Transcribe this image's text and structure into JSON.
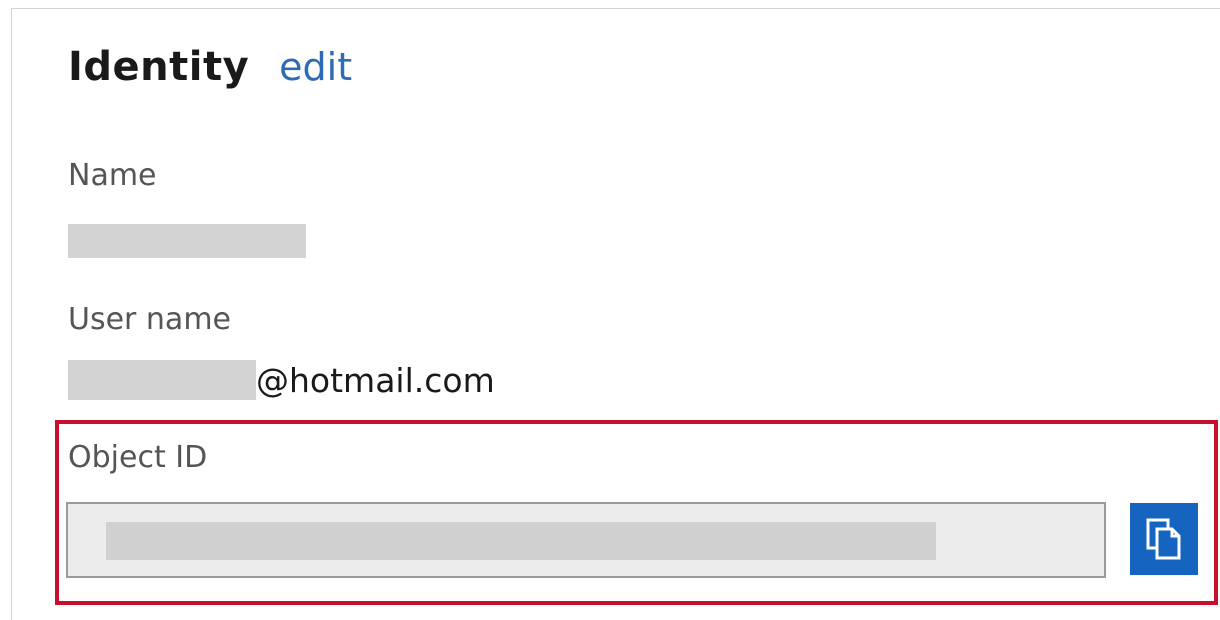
{
  "identity": {
    "title": "Identity",
    "edit_label": "edit"
  },
  "fields": {
    "name_label": "Name",
    "username_label": "User name",
    "username_suffix": "@hotmail.com",
    "object_id_label": "Object ID"
  },
  "icons": {
    "copy": "copy-icon"
  },
  "colors": {
    "link": "#2d6cb5",
    "highlight": "#c8102e",
    "copy_button": "#1565c0"
  }
}
